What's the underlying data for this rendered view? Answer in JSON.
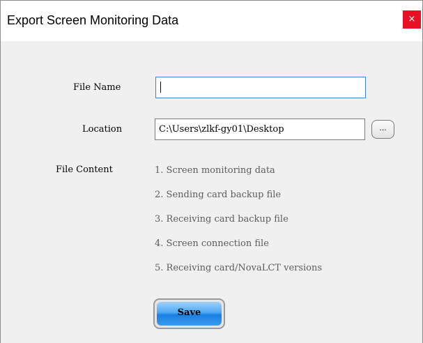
{
  "window": {
    "title": "Export Screen Monitoring Data",
    "close_glyph": "×"
  },
  "form": {
    "file_name_label": "File Name",
    "file_name_value": "",
    "location_label": "Location",
    "location_value": "C:\\Users\\zlkf-gy01\\Desktop",
    "browse_label": "...",
    "file_content_label": "File Content",
    "file_content_items": [
      "1. Screen monitoring data",
      "2. Sending card backup file",
      "3. Receiving card backup file",
      "4. Screen connection file",
      "5. Receiving card/NovaLCT versions"
    ],
    "save_label": "Save"
  },
  "colors": {
    "close_bg": "#e81123",
    "focus_border": "#3c7fd6",
    "save_button": "#1a7fe2"
  },
  "icons": {
    "close": "close-icon"
  }
}
